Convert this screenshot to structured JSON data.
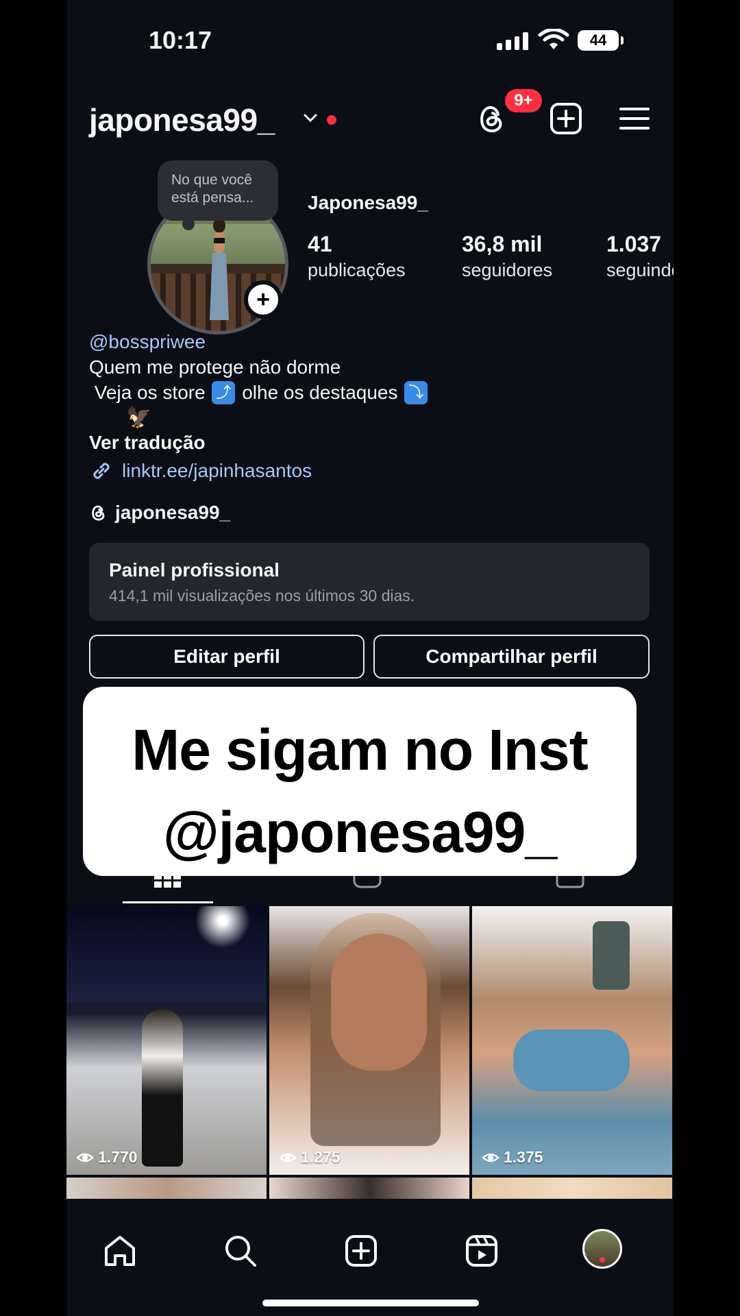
{
  "status_bar": {
    "time": "10:17",
    "battery": "44"
  },
  "header": {
    "username": "japonesa99_",
    "notification_count": "9+"
  },
  "profile": {
    "note": "No que você está pensa...",
    "display_name": "Japonesa99_",
    "stats": [
      {
        "value": "41",
        "label": "publicações"
      },
      {
        "value": "36,8 mil",
        "label": "seguidores"
      },
      {
        "value": "1.037",
        "label": "seguindo"
      }
    ],
    "bio": {
      "mention": "@bosspriwee",
      "line1": "Quem me protege não dorme",
      "line2_a": "Veja os store",
      "line2_b": "olhe os destaques",
      "emoji_up": "⤴",
      "emoji_down": "⤵",
      "emoji_eagle": "🦅"
    },
    "translate": "Ver tradução",
    "link": "linktr.ee/japinhasantos",
    "threads_handle": "japonesa99_"
  },
  "panel": {
    "title": "Painel profissional",
    "subtitle": "414,1 mil visualizações nos últimos 30 dias."
  },
  "buttons": {
    "edit": "Editar perfil",
    "share": "Compartilhar perfil"
  },
  "overlay": {
    "line1": "Me sigam no Inst",
    "line2": "@japonesa99_"
  },
  "posts": [
    {
      "views": "1.770"
    },
    {
      "views": "1.275"
    },
    {
      "views": "1.375"
    }
  ]
}
